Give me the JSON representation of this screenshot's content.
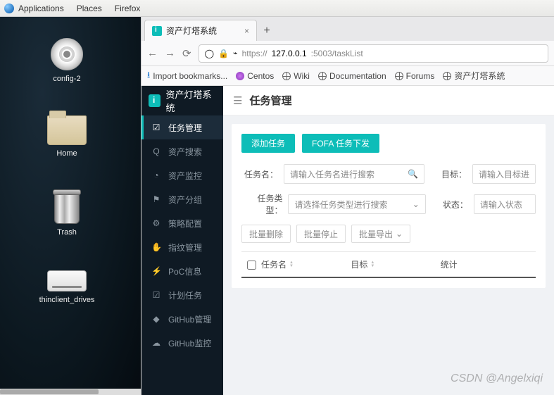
{
  "top_panel": {
    "applications": "Applications",
    "places": "Places",
    "firefox": "Firefox"
  },
  "desktop_icons": {
    "cd": "config-2",
    "home": "Home",
    "trash": "Trash",
    "drives": "thinclient_drives"
  },
  "tab": {
    "title": "资产灯塔系统"
  },
  "url": {
    "prefix": "https://",
    "host": "127.0.0.1",
    "suffix": ":5003/taskList"
  },
  "bookmarks": {
    "import": "Import bookmarks...",
    "centos": "Centos",
    "wiki": "Wiki",
    "docs": "Documentation",
    "forums": "Forums",
    "asset": "资产灯塔系统"
  },
  "side": {
    "logo": "资产灯塔系统",
    "items": [
      {
        "icon": "☑",
        "label": "任务管理"
      },
      {
        "icon": "Q",
        "label": "资产搜索"
      },
      {
        "icon": "◔",
        "label": "资产监控"
      },
      {
        "icon": "⚑",
        "label": "资产分组"
      },
      {
        "icon": "⚙",
        "label": "策略配置"
      },
      {
        "icon": "✋",
        "label": "指纹管理"
      },
      {
        "icon": "⚡",
        "label": "PoC信息"
      },
      {
        "icon": "☑",
        "label": "计划任务"
      },
      {
        "icon": "◆",
        "label": "GitHub管理"
      },
      {
        "icon": "☁",
        "label": "GitHub监控"
      }
    ]
  },
  "content": {
    "heading": "任务管理",
    "btn_add": "添加任务",
    "btn_fofa": "FOFA 任务下发",
    "lbl_name": "任务名：",
    "ph_name": "请输入任务名进行搜索",
    "lbl_target": "目标：",
    "ph_target": "请输入目标进",
    "lbl_type": "任务类型：",
    "ph_type": "请选择任务类型进行搜索",
    "lbl_status": "状态：",
    "ph_status": "请输入状态",
    "btn_del": "批量删除",
    "btn_stop": "批量停止",
    "btn_export": "批量导出",
    "th_name": "任务名",
    "th_target": "目标",
    "th_stat": "统计"
  },
  "watermark": "CSDN @Angelxiqi"
}
